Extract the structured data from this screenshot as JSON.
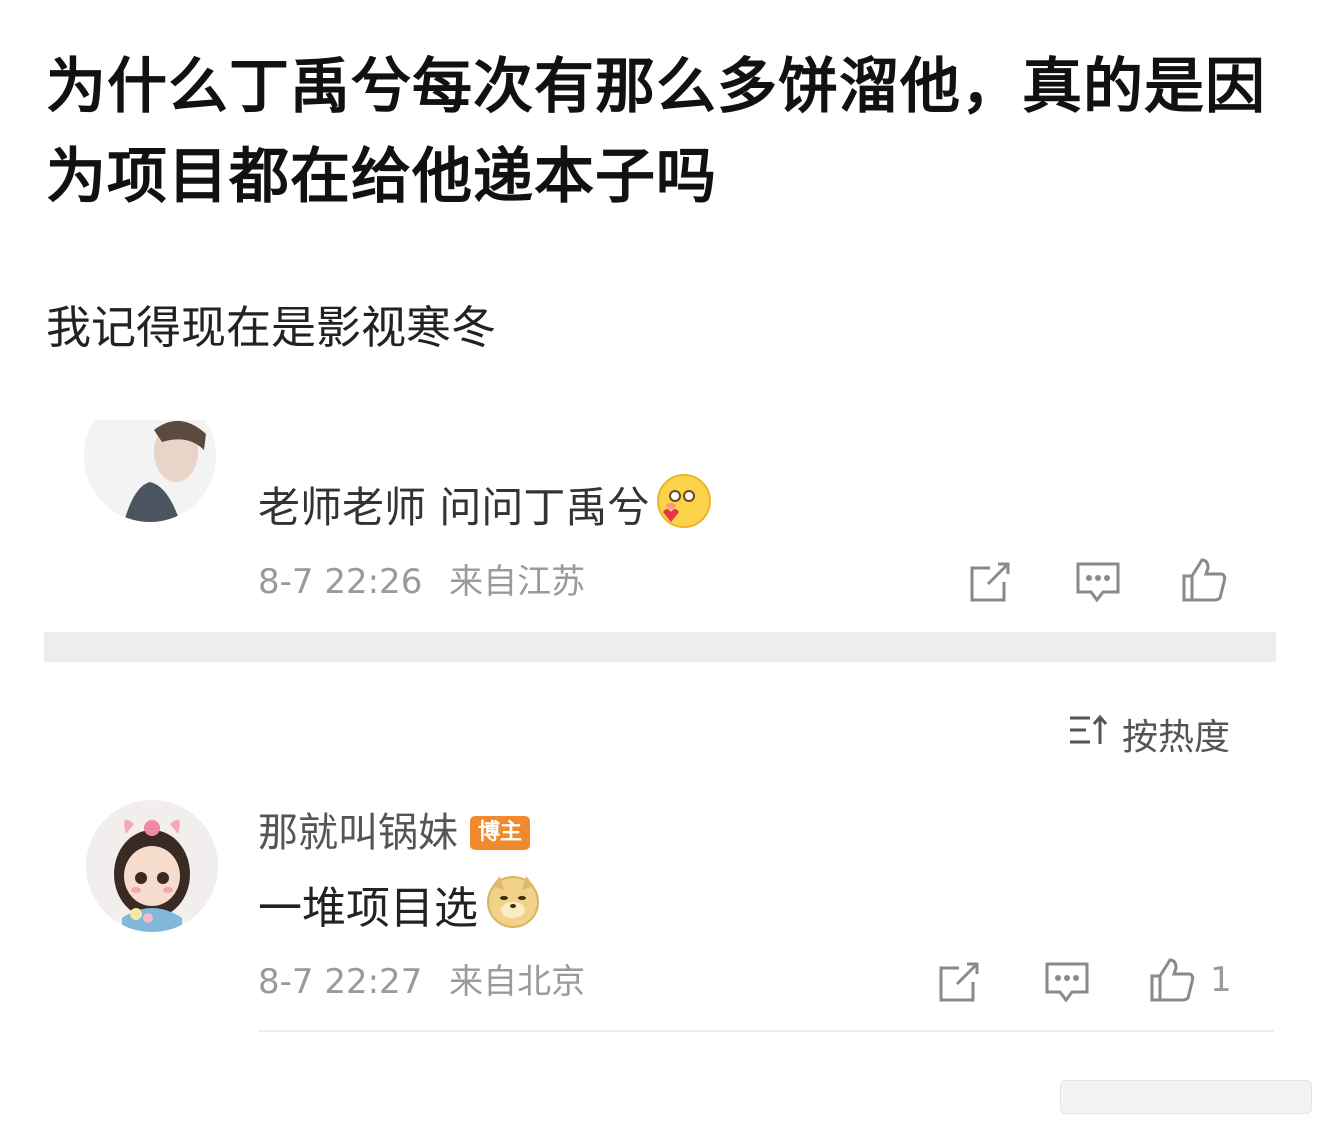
{
  "post": {
    "title": "为什么丁禹兮每次有那么多饼溜他，真的是因为项目都在给他递本子吗",
    "body": "我记得现在是影视寒冬"
  },
  "comment_1": {
    "text": "老师老师 问问丁禹兮",
    "emoji": "blush-heart-emoji",
    "date": "8-7 22:26",
    "location": "来自江苏"
  },
  "sort": {
    "label": "按热度",
    "icon": "sort-icon"
  },
  "comment_2": {
    "username": "那就叫锅妹",
    "badge": "博主",
    "text": "一堆项目选",
    "emoji": "doge-emoji",
    "date": "8-7 22:27",
    "location": "来自北京",
    "like_count": "1"
  },
  "actions": {
    "repost_icon": "share-icon",
    "comment_icon": "comment-icon",
    "like_icon": "thumbs-up-icon"
  },
  "colors": {
    "badge": "#f08a2c",
    "meta_text": "#9a9a9a",
    "divider": "#ededed"
  }
}
